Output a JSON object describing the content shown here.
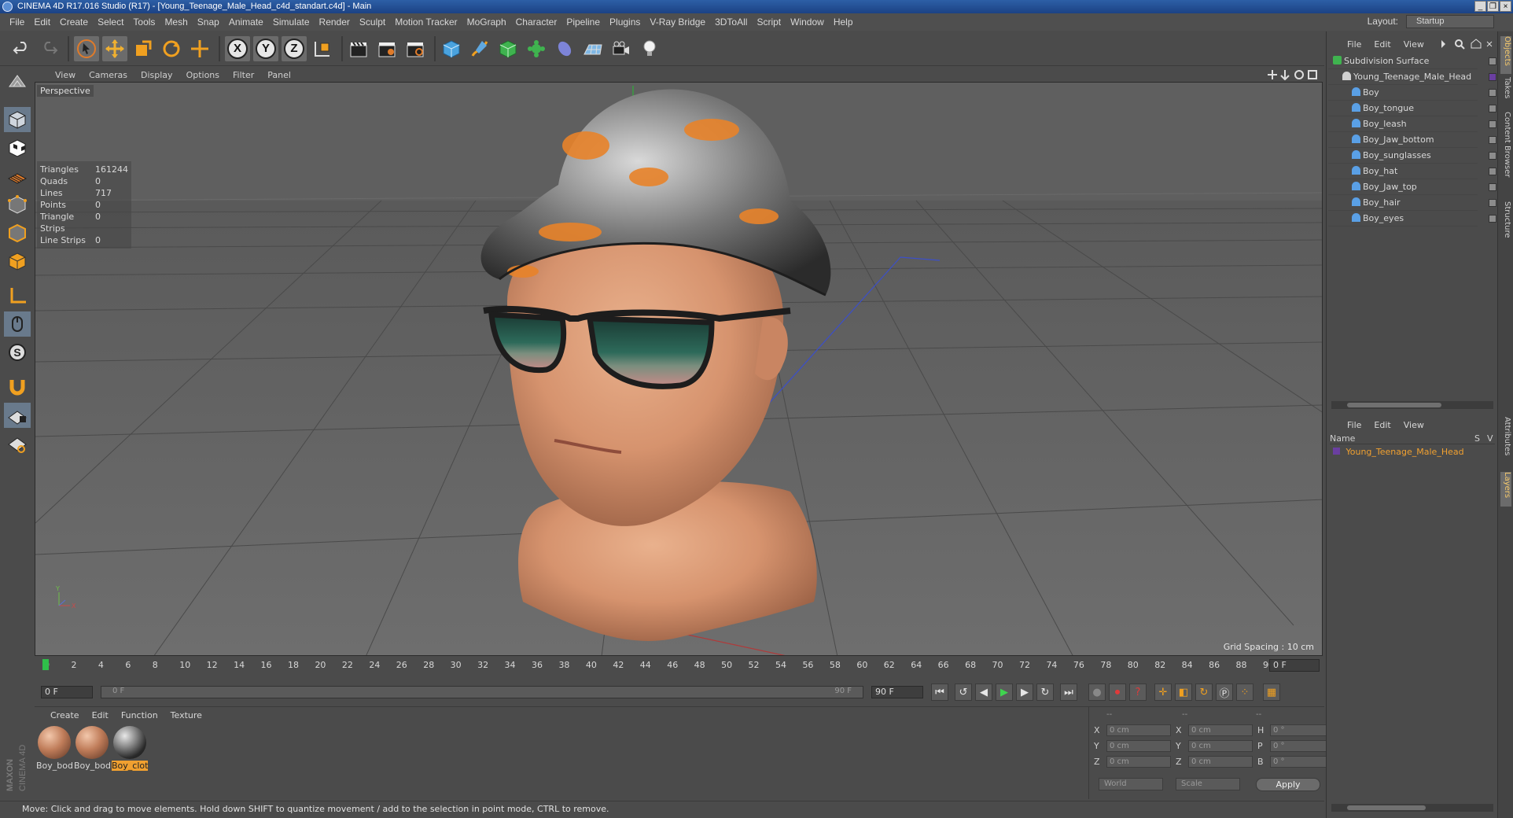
{
  "window": {
    "title": "CINEMA 4D R17.016 Studio (R17) - [Young_Teenage_Male_Head_c4d_standart.c4d] - Main",
    "minimize": "_",
    "restore": "❐",
    "close": "×"
  },
  "menu": [
    "File",
    "Edit",
    "Create",
    "Select",
    "Tools",
    "Mesh",
    "Snap",
    "Animate",
    "Simulate",
    "Render",
    "Sculpt",
    "Motion Tracker",
    "MoGraph",
    "Character",
    "Pipeline",
    "Plugins",
    "V-Ray Bridge",
    "3DToAll",
    "Script",
    "Window",
    "Help"
  ],
  "layout": {
    "label": "Layout:",
    "value": "Startup"
  },
  "toolbar": {
    "axis_x": "X",
    "axis_y": "Y",
    "axis_z": "Z"
  },
  "viewport": {
    "menu": [
      "View",
      "Cameras",
      "Display",
      "Options",
      "Filter",
      "Panel"
    ],
    "label": "Perspective",
    "grid_spacing": "Grid Spacing : 10 cm",
    "stats": [
      {
        "k": "Triangles",
        "v": "161244"
      },
      {
        "k": "Quads",
        "v": "0"
      },
      {
        "k": "Lines",
        "v": "717"
      },
      {
        "k": "Points",
        "v": "0"
      },
      {
        "k": "Triangle Strips",
        "v": "0"
      },
      {
        "k": "Line Strips",
        "v": "0"
      }
    ]
  },
  "timeline": {
    "ticks": [
      "0",
      "2",
      "4",
      "6",
      "8",
      "10",
      "12",
      "14",
      "16",
      "18",
      "20",
      "22",
      "24",
      "26",
      "28",
      "30",
      "32",
      "34",
      "36",
      "38",
      "40",
      "42",
      "44",
      "46",
      "48",
      "50",
      "52",
      "54",
      "56",
      "58",
      "60",
      "62",
      "64",
      "66",
      "68",
      "70",
      "72",
      "74",
      "76",
      "78",
      "80",
      "82",
      "84",
      "86",
      "88",
      "90"
    ],
    "current_frame": "0 F"
  },
  "transport": {
    "start": "0 F",
    "range_start": "0 F",
    "range_end": "90 F",
    "end": "90 F"
  },
  "materials": {
    "menu": [
      "Create",
      "Edit",
      "Function",
      "Texture"
    ],
    "items": [
      {
        "name": "Boy_bod",
        "selected": false
      },
      {
        "name": "Boy_bod",
        "selected": false
      },
      {
        "name": "Boy_clot",
        "selected": true
      }
    ]
  },
  "coordinates": {
    "dashes": [
      "--",
      "--",
      "--"
    ],
    "rows": [
      {
        "a": "X",
        "av": "0 cm",
        "b": "X",
        "bv": "0 cm",
        "c": "H",
        "cv": "0 °"
      },
      {
        "a": "Y",
        "av": "0 cm",
        "b": "Y",
        "bv": "0 cm",
        "c": "P",
        "cv": "0 °"
      },
      {
        "a": "Z",
        "av": "0 cm",
        "b": "Z",
        "bv": "0 cm",
        "c": "B",
        "cv": "0 °"
      }
    ],
    "world": "World",
    "scale": "Scale",
    "apply": "Apply"
  },
  "status": "Move: Click and drag to move elements. Hold down SHIFT to quantize movement / add to the selection in point mode, CTRL to remove.",
  "objects_panel": {
    "menu": [
      "File",
      "Edit",
      "View"
    ],
    "items": [
      {
        "name": "Subdivision Surface",
        "level": 0,
        "color": "#3fb34f"
      },
      {
        "name": "Young_Teenage_Male_Head",
        "level": 1,
        "color": "#d0d0d0"
      },
      {
        "name": "Boy",
        "level": 2,
        "color": "#5aa0e6"
      },
      {
        "name": "Boy_tongue",
        "level": 2,
        "color": "#5aa0e6"
      },
      {
        "name": "Boy_leash",
        "level": 2,
        "color": "#5aa0e6"
      },
      {
        "name": "Boy_Jaw_bottom",
        "level": 2,
        "color": "#5aa0e6"
      },
      {
        "name": "Boy_sunglasses",
        "level": 2,
        "color": "#5aa0e6"
      },
      {
        "name": "Boy_hat",
        "level": 2,
        "color": "#5aa0e6"
      },
      {
        "name": "Boy_Jaw_top",
        "level": 2,
        "color": "#5aa0e6"
      },
      {
        "name": "Boy_hair",
        "level": 2,
        "color": "#5aa0e6"
      },
      {
        "name": "Boy_eyes",
        "level": 2,
        "color": "#5aa0e6"
      }
    ]
  },
  "layers_panel": {
    "menu": [
      "File",
      "Edit",
      "View"
    ],
    "col_name": "Name",
    "col_s": "S",
    "col_v": "V",
    "layer": "Young_Teenage_Male_Head"
  },
  "side_tabs": [
    "Objects",
    "Takes",
    "Content Browser",
    "Structure",
    "Attributes",
    "Layers"
  ],
  "logo": "MAXON CINEMA 4D"
}
